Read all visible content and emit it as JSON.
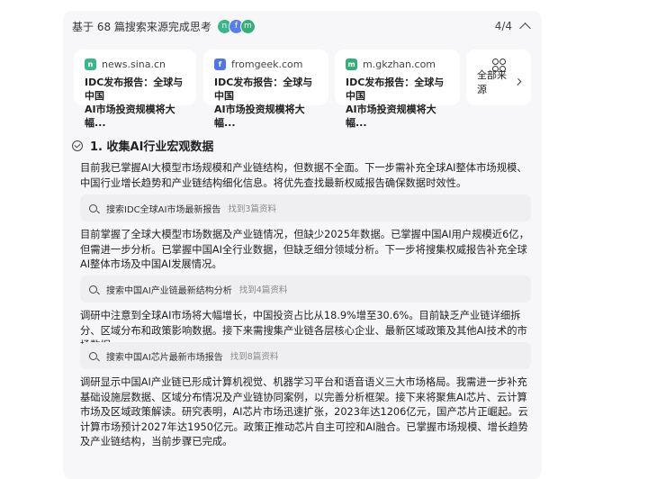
{
  "header": {
    "title": "基于 68 篇搜索来源完成思考",
    "avatars": [
      {
        "letter": "n",
        "color": "#3bb58a"
      },
      {
        "letter": "f",
        "color": "#5a7cf0"
      },
      {
        "letter": "m",
        "color": "#33b07a"
      }
    ],
    "page_indicator": "4/4"
  },
  "sources": [
    {
      "site": "news.sina.cn",
      "icon_letter": "n",
      "icon_color": "#3bb58a",
      "title": "IDC发布报告：全球与中国\nAI市场投资规模将大幅..."
    },
    {
      "site": "fromgeek.com",
      "icon_letter": "f",
      "icon_color": "#4f74ee",
      "title": "IDC发布报告：全球与中国\nAI市场投资规模将大幅..."
    },
    {
      "site": "m.gkzhan.com",
      "icon_letter": "m",
      "icon_color": "#33b07a",
      "title": "IDC发布报告：全球与中国\nAI市场投资规模将大幅..."
    }
  ],
  "all_sources_label": "全部来源",
  "step": {
    "title": "1. 收集AI行业宏观数据"
  },
  "paragraphs": [
    "目前我已掌握AI大模型市场规模和产业链结构，但数据不全面。下一步需补充全球AI整体市场规模、中国行业增长趋势和产业链结构细化信息。将优先查找最新权威报告确保数据时效性。",
    "目前掌握了全球大模型市场数据及产业链情况，但缺少2025年数据。已掌握中国AI用户规模近6亿，但需进一步分析。已掌握中国AI全行业数据，但缺乏细分领域分析。下一步将搜集权威报告补充全球AI整体市场及中国AI发展情况。",
    "调研中注意到全球AI市场将大幅增长，中国投资占比从18.9%增至30.6%。目前缺乏产业链详细拆分、区域分布和政策影响数据。接下来需搜集产业链各层核心企业、最新区域政策及其他AI技术的市场数据。",
    "调研显示中国AI产业链已形成计算机视觉、机器学习平台和语音语义三大市场格局。我需进一步补充基础设施层数据、区域分布情况及产业链协同案例，以完善分析框架。接下来将聚焦AI芯片、云计算市场及区域政策解读。研究表明，AI芯片市场迅速扩张，2023年达1206亿元，国产芯片正崛起。云计算市场预计2027年达1950亿元。政策正推动芯片自主可控和AI融合。已掌握市场规模、增长趋势及产业链结构，当前步骤已完成。"
  ],
  "searches": [
    {
      "query": "搜索IDC全球AI市场最新报告",
      "found": "找到3篇资料"
    },
    {
      "query": "搜索中国AI产业链最新结构分析",
      "found": "找到4篇资料"
    },
    {
      "query": "搜索中国AI芯片最新市场报告",
      "found": "找到8篇资料"
    }
  ]
}
